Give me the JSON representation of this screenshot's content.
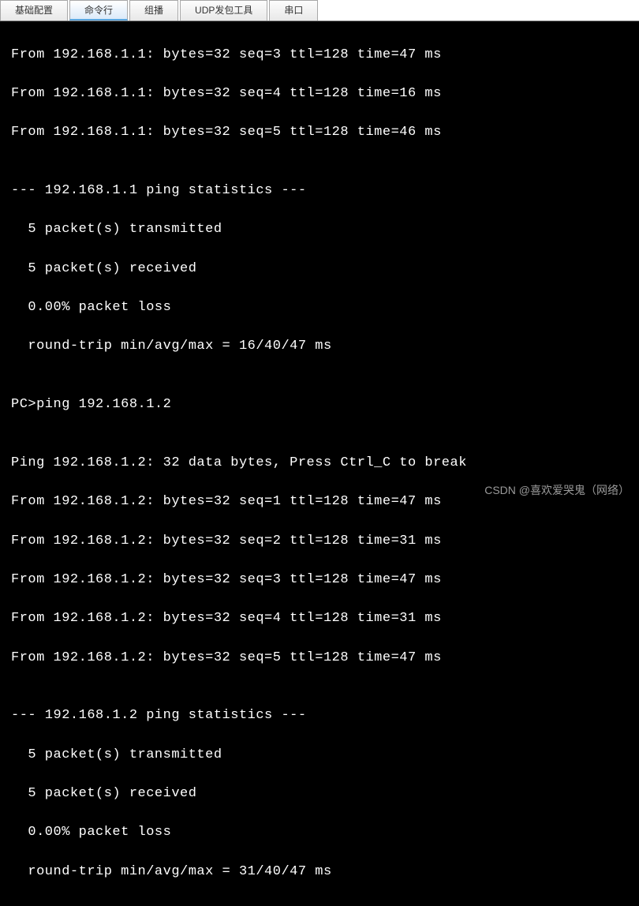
{
  "tabs": [
    {
      "label": "基础配置",
      "active": false
    },
    {
      "label": "命令行",
      "active": true
    },
    {
      "label": "组播",
      "active": false
    },
    {
      "label": "UDP发包工具",
      "active": false
    },
    {
      "label": "串口",
      "active": false
    }
  ],
  "terminal": {
    "lines": [
      "From 192.168.1.1: bytes=32 seq=3 ttl=128 time=47 ms",
      "From 192.168.1.1: bytes=32 seq=4 ttl=128 time=16 ms",
      "From 192.168.1.1: bytes=32 seq=5 ttl=128 time=46 ms",
      "",
      "--- 192.168.1.1 ping statistics ---",
      "  5 packet(s) transmitted",
      "  5 packet(s) received",
      "  0.00% packet loss",
      "  round-trip min/avg/max = 16/40/47 ms",
      "",
      "PC>ping 192.168.1.2",
      "",
      "Ping 192.168.1.2: 32 data bytes, Press Ctrl_C to break",
      "From 192.168.1.2: bytes=32 seq=1 ttl=128 time=47 ms",
      "From 192.168.1.2: bytes=32 seq=2 ttl=128 time=31 ms",
      "From 192.168.1.2: bytes=32 seq=3 ttl=128 time=47 ms",
      "From 192.168.1.2: bytes=32 seq=4 ttl=128 time=31 ms",
      "From 192.168.1.2: bytes=32 seq=5 ttl=128 time=47 ms",
      "",
      "--- 192.168.1.2 ping statistics ---",
      "  5 packet(s) transmitted",
      "  5 packet(s) received",
      "  0.00% packet loss",
      "  round-trip min/avg/max = 31/40/47 ms"
    ]
  },
  "watermark": "CSDN @喜欢爱哭鬼（网络）"
}
